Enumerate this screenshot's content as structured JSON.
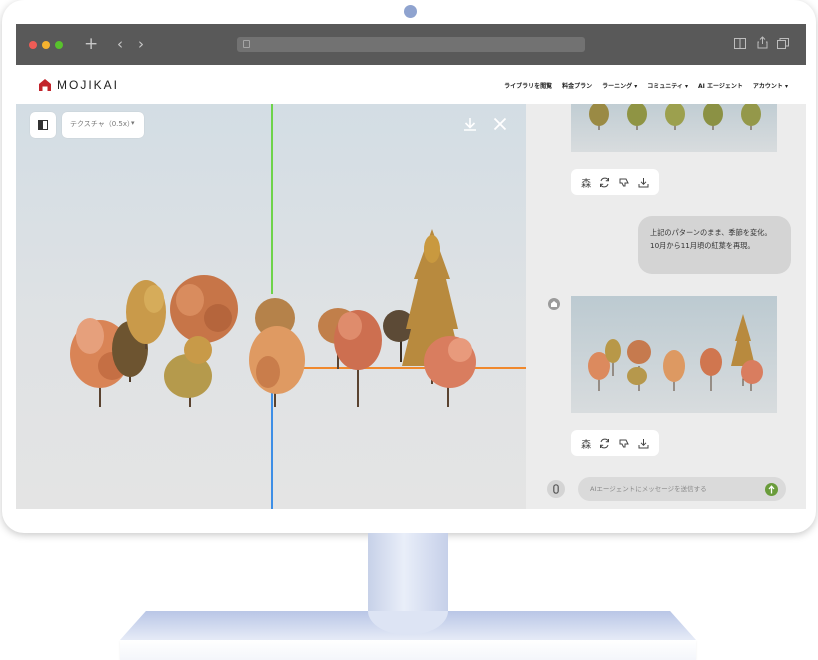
{
  "site": {
    "logo_text": "MOJIKAI"
  },
  "nav": [
    {
      "label": "ライブラリを閲覧"
    },
    {
      "label": "料金プラン"
    },
    {
      "label": "ラーニング ▾"
    },
    {
      "label": "コミュニティ ▾"
    },
    {
      "label": "AI エージェント"
    },
    {
      "label": "アカウント ▾"
    }
  ],
  "viewer": {
    "texture_select": "テクスチャ（0.5x）"
  },
  "chat": {
    "user_message": "上記のパターンのまま、季節を変化。10月から11月頃の紅葉を再現。",
    "input_placeholder": "AIエージェントにメッセージを送信する"
  },
  "icons": {
    "panel_toggle": "panel-toggle-icon",
    "download": "download-icon",
    "close": "close-icon",
    "regenerate": "refresh-icon",
    "dislike": "thumbs-down-icon",
    "attach": "attach-icon",
    "send": "send-arrow-icon"
  },
  "colors": {
    "brand": "#c2232b",
    "axis_x": "#f0882c",
    "axis_y": "#6ed34a",
    "axis_z": "#3d8ee6",
    "send": "#6a9c3b"
  }
}
